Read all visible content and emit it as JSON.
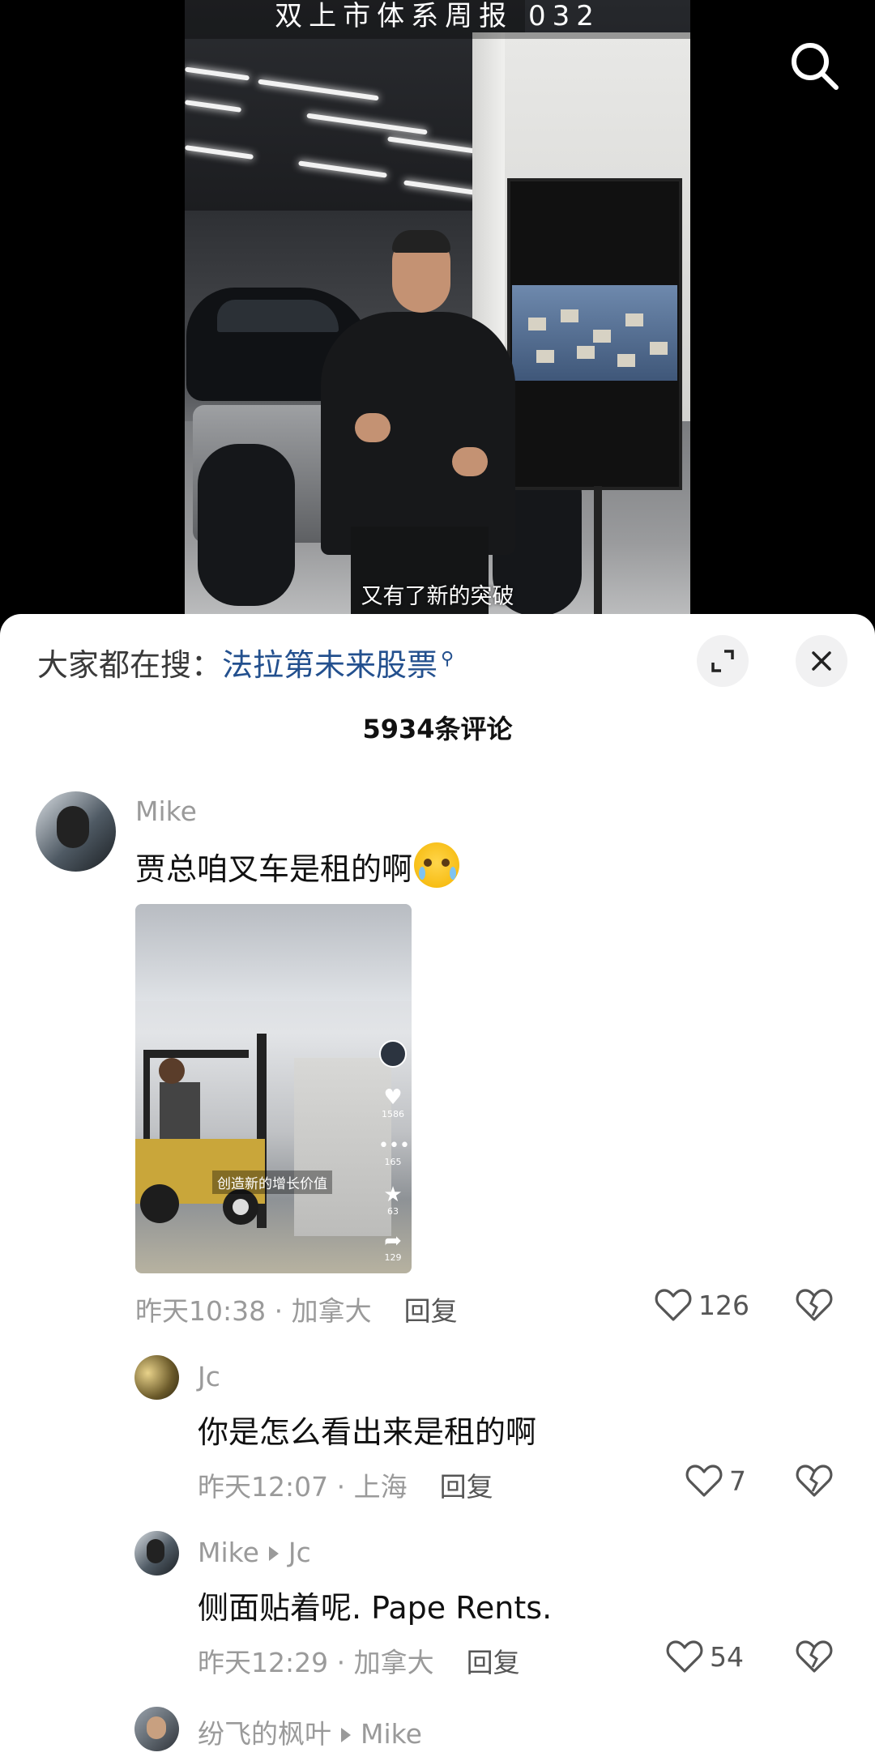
{
  "video": {
    "top_title": "双上市体系周报 032",
    "caption": "又有了新的突破"
  },
  "search_hint": {
    "prefix": "大家都在搜：",
    "keyword": "法拉第未来股票"
  },
  "comment_count": "5934条评论",
  "comments": [
    {
      "user": "Mike",
      "text": "贾总咱叉车是租的啊",
      "time_location": "昨天10:38 · 加拿大",
      "reply_label": "回复",
      "likes": "126",
      "image": {
        "caption": "创造新的增长价值",
        "like_count": "1586",
        "comment_count": "165",
        "fav_count": "63",
        "share_count": "129"
      }
    }
  ],
  "replies": [
    {
      "user": "Jc",
      "to": "",
      "text": "你是怎么看出来是租的啊",
      "time_location": "昨天12:07 · 上海",
      "reply_label": "回复",
      "likes": "7"
    },
    {
      "user": "Mike",
      "to": "Jc",
      "text": "侧面贴着呢. Pape Rents.",
      "time_location": "昨天12:29 · 加拿大",
      "reply_label": "回复",
      "likes": "54"
    },
    {
      "user": "纷飞的枫叶",
      "to": "Mike",
      "text": "",
      "time_location": "",
      "reply_label": "",
      "likes": ""
    }
  ],
  "icons": {
    "search": "search-icon",
    "expand": "expand-icon",
    "close": "close-icon",
    "like": "heart-icon",
    "dislike": "broken-heart-icon"
  }
}
